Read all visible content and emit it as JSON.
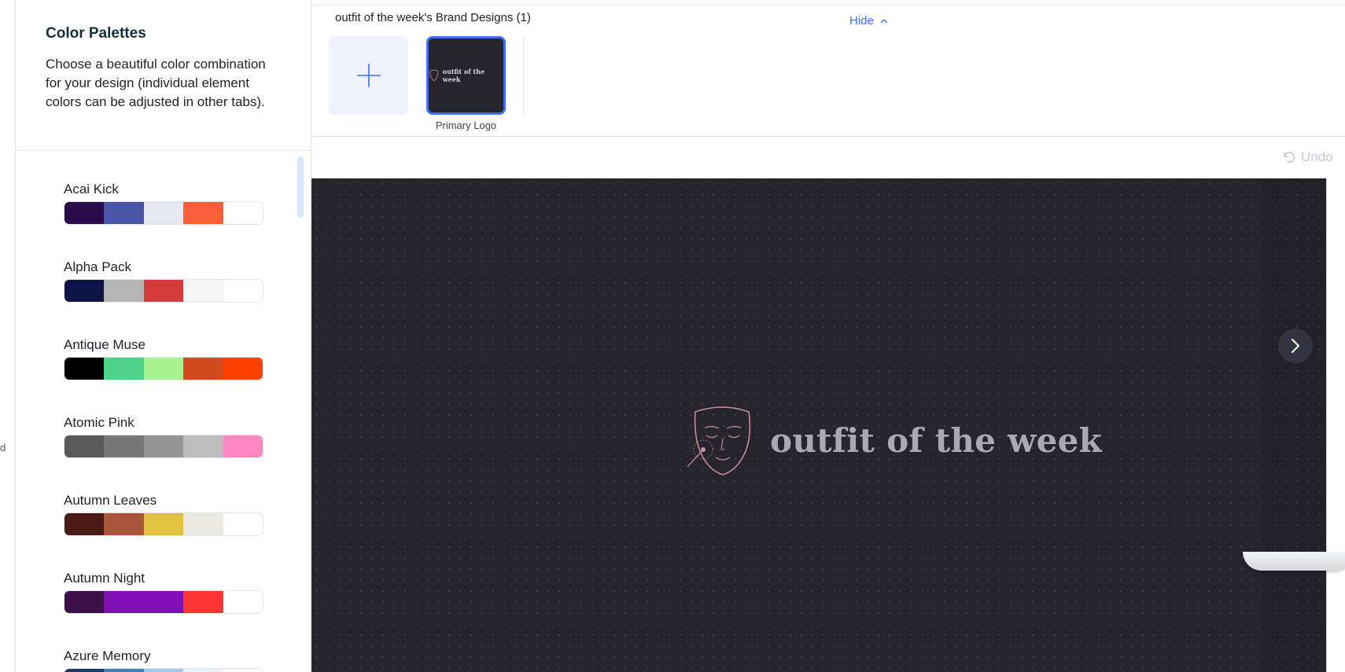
{
  "left_strip": {
    "text": "d"
  },
  "panel": {
    "title": "Color Palettes",
    "description": "Choose a beautiful color combination for your design (individual element colors can be adjusted in other tabs).",
    "palettes": [
      {
        "name": "Acai Kick",
        "colors": [
          "#2b0c4a",
          "#4a55a8",
          "#e6e8f4",
          "#fb5e3b",
          "#ffffff"
        ]
      },
      {
        "name": "Alpha Pack",
        "colors": [
          "#0f1447",
          "#b5b5b5",
          "#d63c3c",
          "#f5f5f5",
          "#ffffff"
        ]
      },
      {
        "name": "Antique Muse",
        "colors": [
          "#000000",
          "#4fd38a",
          "#a9f38f",
          "#d04a1f",
          "#ff4000"
        ]
      },
      {
        "name": "Atomic Pink",
        "colors": [
          "#595959",
          "#777777",
          "#959595",
          "#bcbcbc",
          "#ff88c2"
        ]
      },
      {
        "name": "Autumn Leaves",
        "colors": [
          "#4b1a15",
          "#a9573a",
          "#e0c140",
          "#ebe8de",
          "#ffffff"
        ]
      },
      {
        "name": "Autumn Night",
        "colors": [
          "#3a1248",
          "#7f0fb5",
          "#7f0fb5",
          "#ff3434",
          "#ffffff"
        ]
      },
      {
        "name": "Azure Memory",
        "colors": [
          "#1f3a5f",
          "#3f7fbf",
          "#9fcbe8",
          "#e8f2fa",
          "#ffffff"
        ]
      }
    ]
  },
  "brand": {
    "title": "outfit of the week's Brand Designs (1)",
    "hide_label": "Hide",
    "logo_caption": "Primary Logo",
    "mini_logo_text": "outfit of the week"
  },
  "toolbar": {
    "undo_label": "Undo"
  },
  "canvas": {
    "logo_text": "outfit of the week"
  },
  "colors": {
    "accent": "#3b6ff5",
    "canvas_bg": "#26252c",
    "logo_pink": "#c98c99"
  }
}
